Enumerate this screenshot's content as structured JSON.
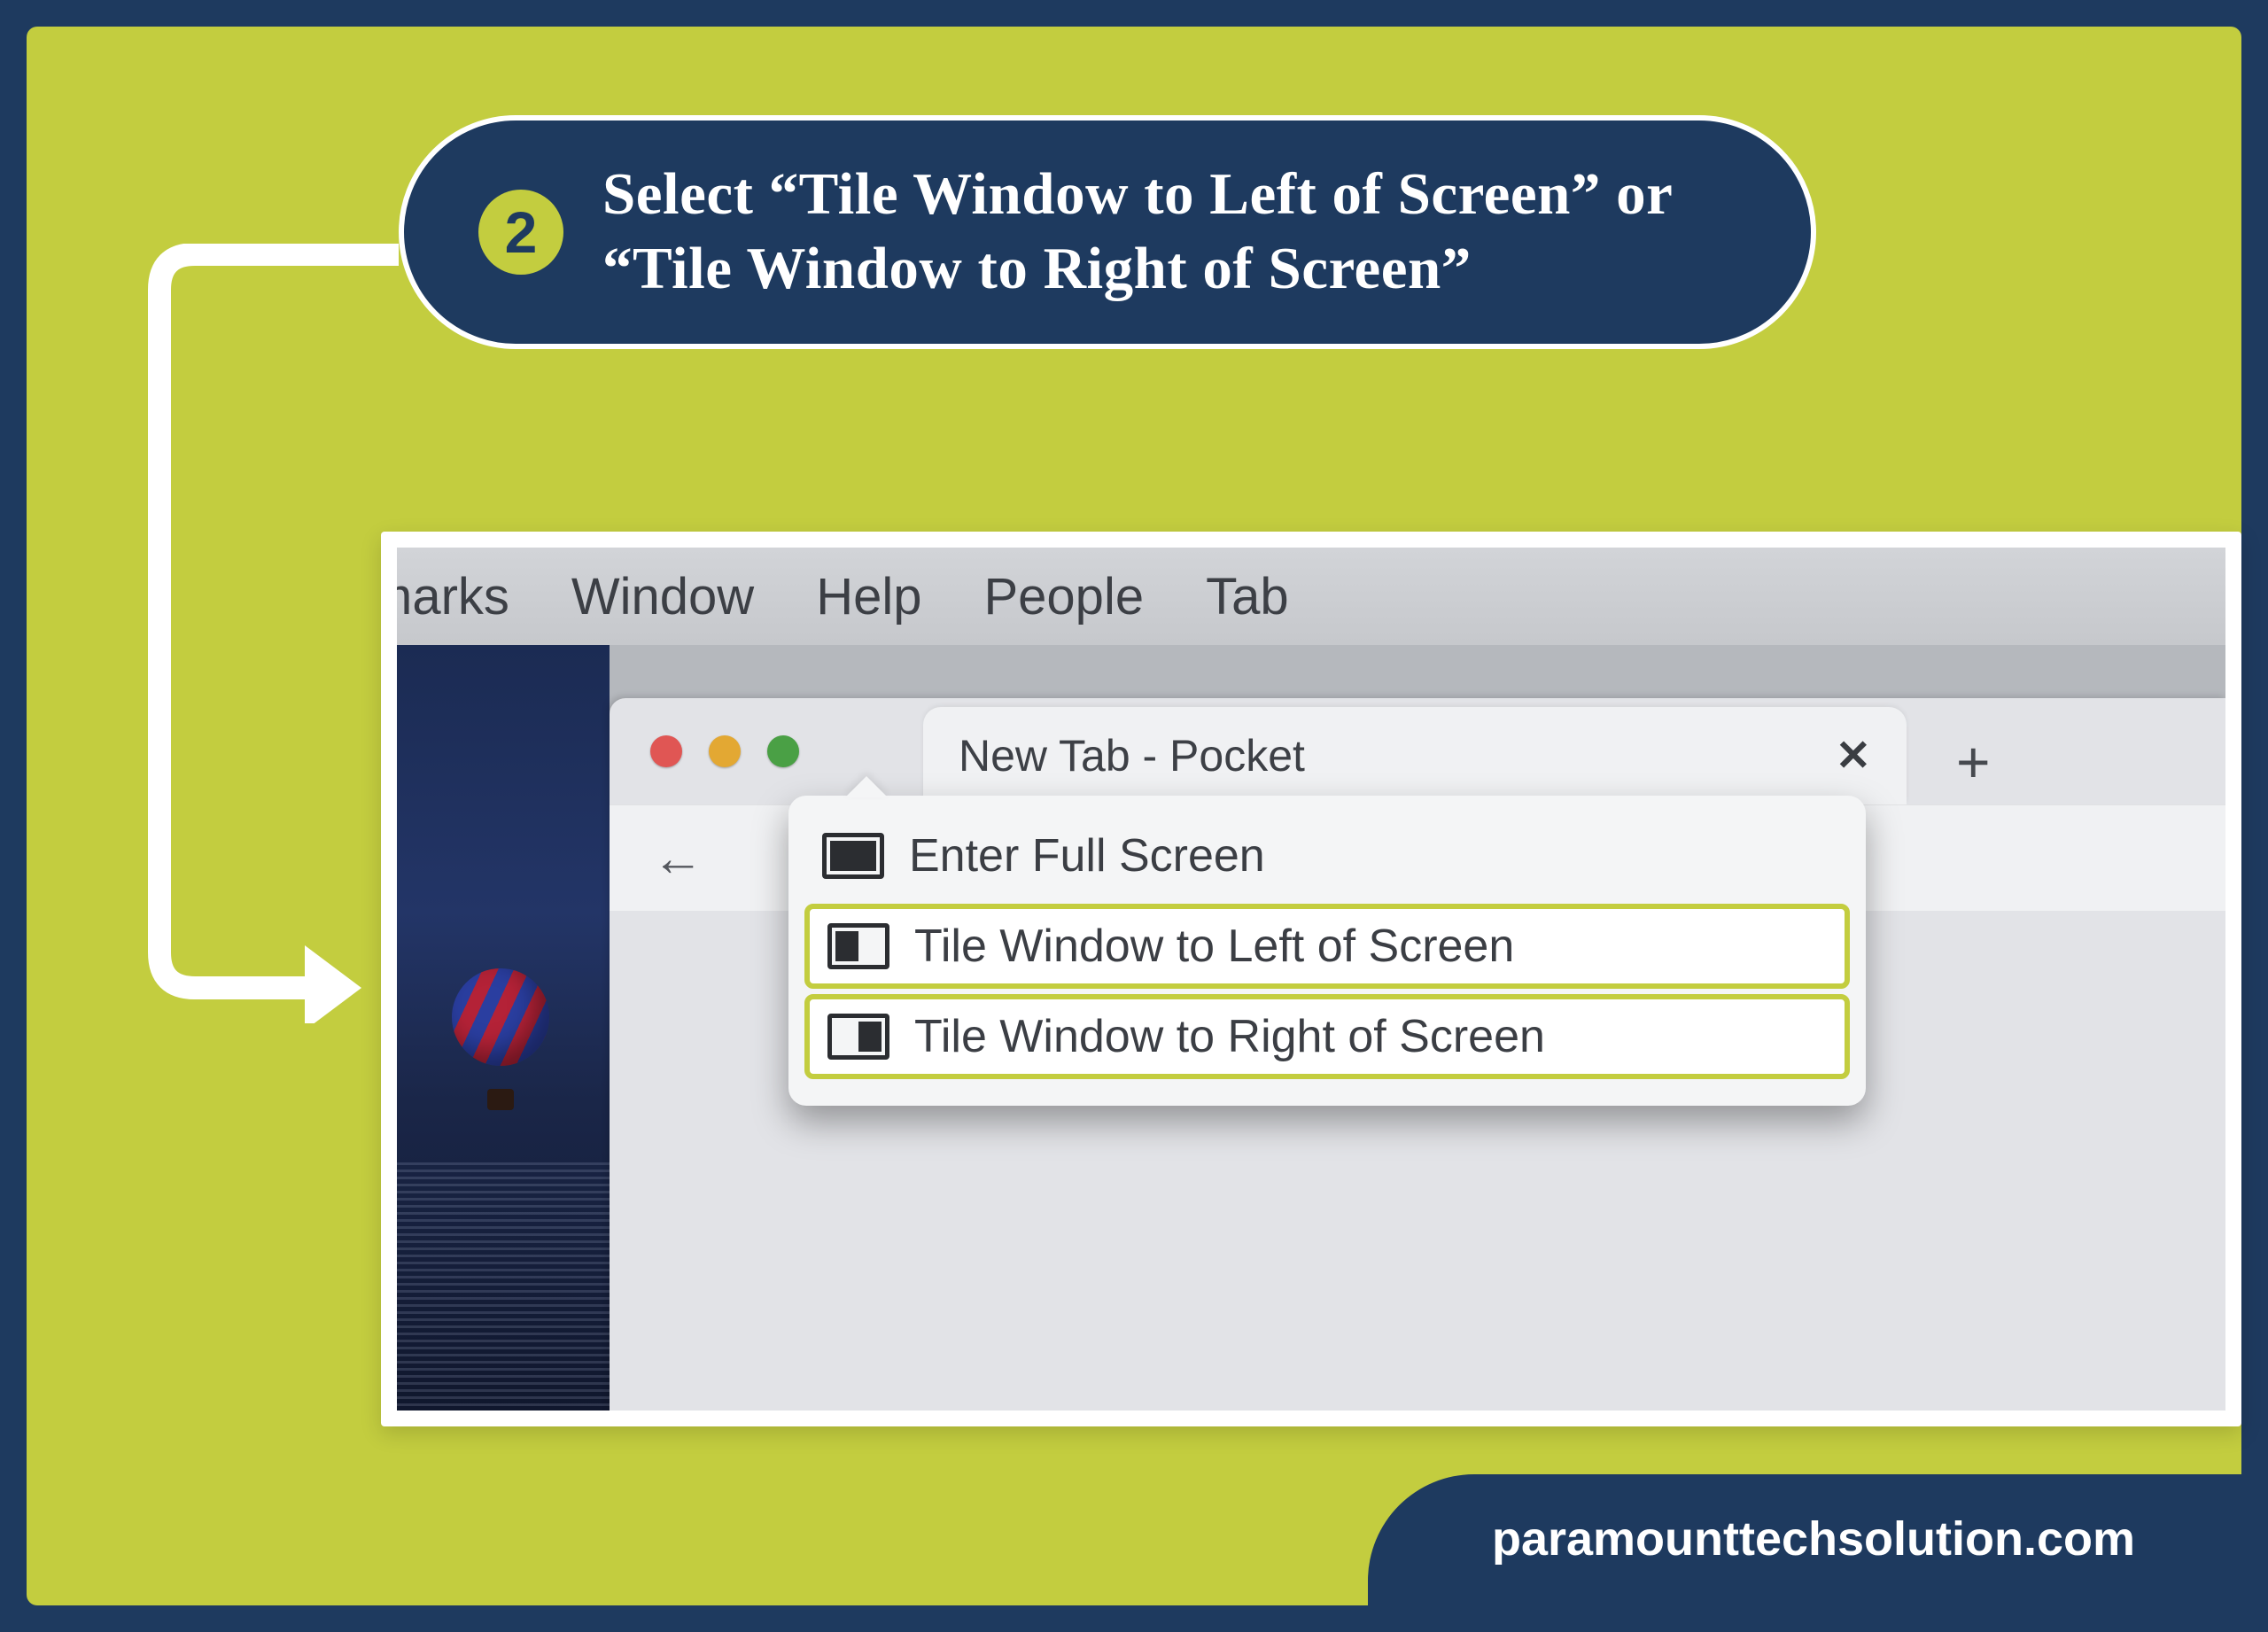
{
  "step": {
    "number": "2",
    "text": "Select “Tile Window to Left of Screen” or “Tile Window to Right of Screen”"
  },
  "menubar": {
    "items": [
      "kmarks",
      "Window",
      "Help",
      "People",
      "Tab"
    ]
  },
  "browser": {
    "tab_title": "New Tab - Pocket",
    "close_glyph": "✕",
    "plus_glyph": "+",
    "back_glyph": "←"
  },
  "popup": {
    "items": [
      {
        "label": "Enter Full Screen",
        "icon": "full",
        "highlight": false
      },
      {
        "label": "Tile Window to Left of Screen",
        "icon": "left",
        "highlight": true
      },
      {
        "label": "Tile Window to Right of Screen",
        "icon": "right",
        "highlight": true
      }
    ]
  },
  "footer": {
    "brand": "paramounttechsolution.com"
  }
}
